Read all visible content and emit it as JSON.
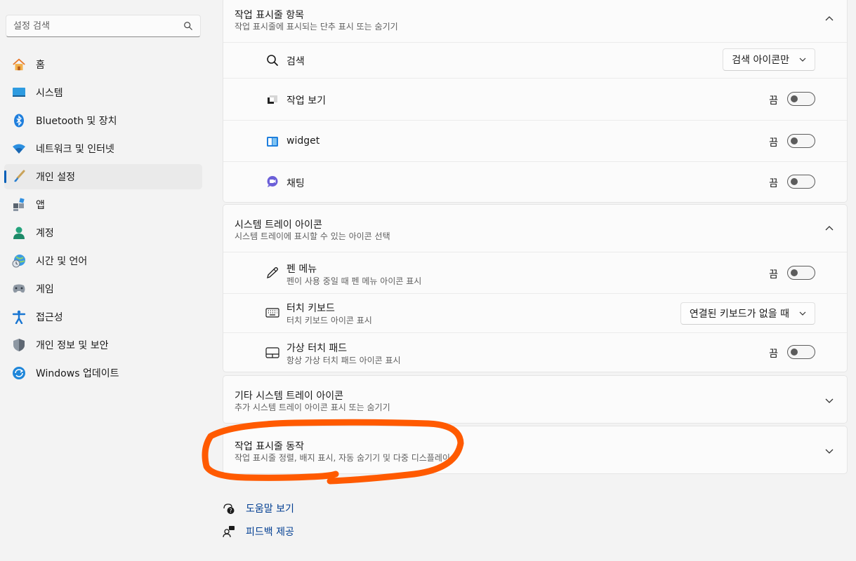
{
  "search": {
    "placeholder": "설정 검색"
  },
  "sidebar": {
    "items": [
      {
        "label": "홈",
        "icon": "home-icon"
      },
      {
        "label": "시스템",
        "icon": "system-icon"
      },
      {
        "label": "Bluetooth 및 장치",
        "icon": "bluetooth-icon"
      },
      {
        "label": "네트워크 및 인터넷",
        "icon": "wifi-icon"
      },
      {
        "label": "개인 설정",
        "icon": "brush-icon",
        "active": true
      },
      {
        "label": "앱",
        "icon": "apps-icon"
      },
      {
        "label": "계정",
        "icon": "account-icon"
      },
      {
        "label": "시간 및 언어",
        "icon": "time-language-icon"
      },
      {
        "label": "게임",
        "icon": "gamepad-icon"
      },
      {
        "label": "접근성",
        "icon": "accessibility-icon"
      },
      {
        "label": "개인 정보 및 보안",
        "icon": "shield-icon"
      },
      {
        "label": "Windows 업데이트",
        "icon": "update-icon"
      }
    ]
  },
  "taskbar_items": {
    "title": "작업 표시줄 항목",
    "subtitle": "작업 표시줄에 표시되는 단추 표시 또는 숨기기",
    "search": {
      "label": "검색",
      "value": "검색 아이콘만"
    },
    "task_view": {
      "label": "작업 보기",
      "state": "끔"
    },
    "widget": {
      "label": "widget",
      "state": "끔"
    },
    "chat": {
      "label": "채팅",
      "state": "끔"
    }
  },
  "tray_icons": {
    "title": "시스템 트레이 아이콘",
    "subtitle": "시스템 트레이에 표시할 수 있는 아이콘 선택",
    "pen_menu": {
      "label": "펜 메뉴",
      "sub": "펜이 사용 중일 때 펜 메뉴 아이콘 표시",
      "state": "끔"
    },
    "touch_keyboard": {
      "label": "터치 키보드",
      "sub": "터치 키보드 아이콘 표시",
      "value": "연결된 키보드가 없을 때"
    },
    "touchpad": {
      "label": "가상 터치 패드",
      "sub": "항상 가상 터치 패드 아이콘 표시",
      "state": "끔"
    }
  },
  "other_tray": {
    "title": "기타 시스템 트레이 아이콘",
    "subtitle": "추가 시스템 트레이 아이콘 표시 또는 숨기기"
  },
  "behaviors": {
    "title": "작업 표시줄 동작",
    "subtitle": "작업 표시줄 정렬, 배지 표시, 자동 숨기기 및 다중 디스플레이"
  },
  "links": {
    "help": "도움말 보기",
    "feedback": "피드백 제공"
  },
  "colors": {
    "accent": "#005fb8",
    "annotation": "#ff5a00",
    "link": "#003e92"
  }
}
